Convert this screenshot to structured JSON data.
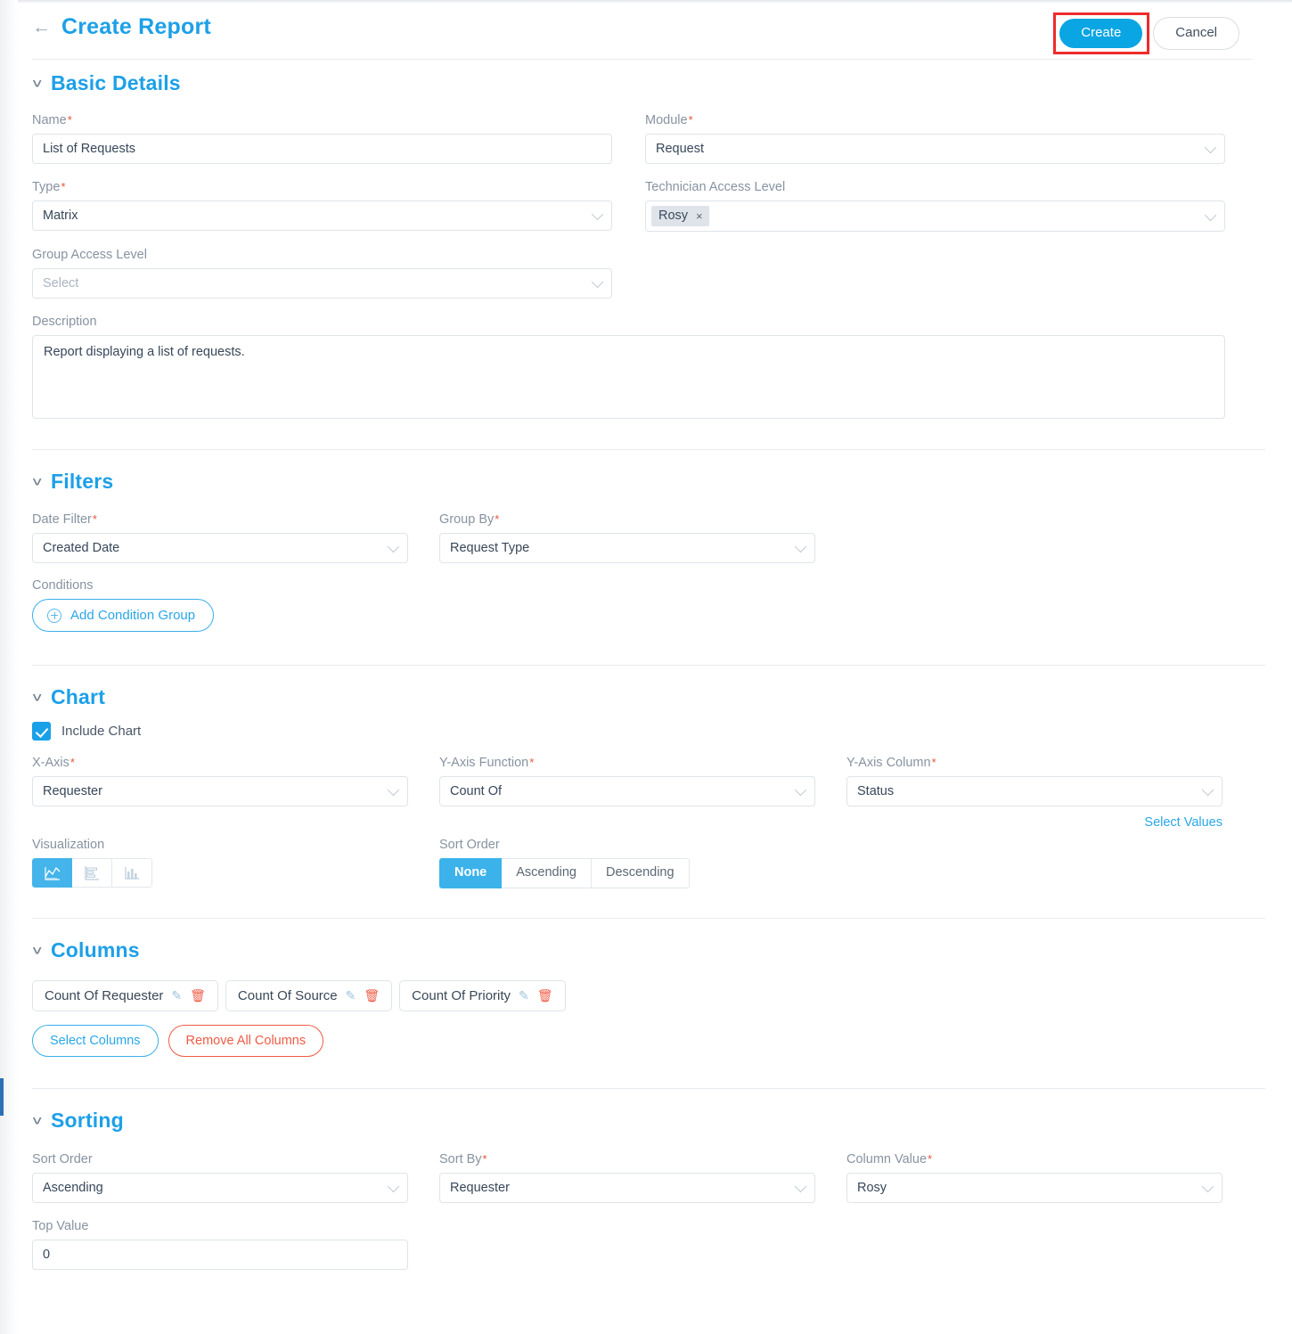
{
  "header": {
    "back_icon": "arrow-left-icon",
    "title": "Create Report",
    "create_label": "Create",
    "cancel_label": "Cancel",
    "highlight_color": "#ee2b2b",
    "accent_color": "#0aa5e3"
  },
  "sections": {
    "basic": {
      "title": "Basic Details"
    },
    "filters": {
      "title": "Filters"
    },
    "chart": {
      "title": "Chart"
    },
    "columns": {
      "title": "Columns"
    },
    "sorting": {
      "title": "Sorting"
    }
  },
  "basic": {
    "name_label": "Name",
    "name_value": "List of Requests",
    "module_label": "Module",
    "module_value": "Request",
    "type_label": "Type",
    "type_value": "Matrix",
    "tech_access_label": "Technician Access Level",
    "tech_access_token": "Rosy",
    "tech_access_token_remove": "×",
    "group_access_label": "Group Access Level",
    "group_access_placeholder": "Select",
    "description_label": "Description",
    "description_value": "Report displaying a list of requests."
  },
  "filters": {
    "date_filter_label": "Date Filter",
    "date_filter_value": "Created Date",
    "group_by_label": "Group By",
    "group_by_value": "Request Type",
    "conditions_label": "Conditions",
    "add_condition_label": "Add Condition Group"
  },
  "chart": {
    "include_chart_label": "Include Chart",
    "include_chart_checked": true,
    "x_axis_label": "X-Axis",
    "x_axis_value": "Requester",
    "y_axis_function_label": "Y-Axis Function",
    "y_axis_function_value": "Count Of",
    "y_axis_column_label": "Y-Axis Column",
    "y_axis_column_value": "Status",
    "select_values_link": "Select Values",
    "visualization_label": "Visualization",
    "visualization_options": [
      {
        "icon": "line-chart-icon",
        "active": true
      },
      {
        "icon": "horizontal-bar-chart-icon",
        "active": false
      },
      {
        "icon": "vertical-bar-chart-icon",
        "active": false
      }
    ],
    "sort_order_label": "Sort Order",
    "sort_order_options": [
      "None",
      "Ascending",
      "Descending"
    ],
    "sort_order_selected": "None"
  },
  "columns": {
    "chips": [
      {
        "label": "Count Of Requester",
        "edit_icon": "pencil-icon",
        "delete_icon": "trash-icon"
      },
      {
        "label": "Count Of Source",
        "edit_icon": "pencil-icon",
        "delete_icon": "trash-icon"
      },
      {
        "label": "Count Of Priority",
        "edit_icon": "pencil-icon",
        "delete_icon": "trash-icon"
      }
    ],
    "select_columns_label": "Select Columns",
    "remove_all_label": "Remove All Columns"
  },
  "sorting": {
    "sort_order_label": "Sort Order",
    "sort_order_value": "Ascending",
    "sort_by_label": "Sort By",
    "sort_by_value": "Requester",
    "column_value_label": "Column Value",
    "column_value_value": "Rosy",
    "top_value_label": "Top Value",
    "top_value_value": "0"
  },
  "required_marker": "*"
}
